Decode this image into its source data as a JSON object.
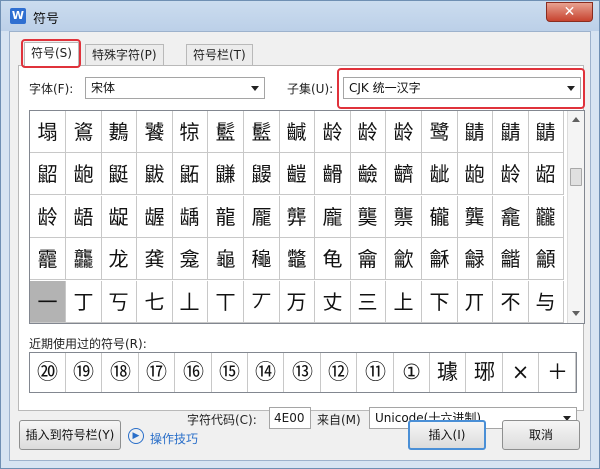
{
  "window": {
    "title": "符号",
    "close_label": "✕",
    "app_icon_label": "W"
  },
  "tabs": [
    {
      "label": "符号(S)"
    },
    {
      "label": "特殊字符(P)"
    },
    {
      "label": "符号栏(T)"
    }
  ],
  "font": {
    "label": "字体(F):",
    "value": "宋体"
  },
  "subset": {
    "label": "子集(U):",
    "value": "CJK 统一汉字"
  },
  "symbol_rows": [
    [
      "塌",
      "䳐",
      "鶈",
      "饕",
      "㹁",
      "䰐",
      "䰐",
      "䶢",
      "龄",
      "龄",
      "龄",
      "鹭",
      "鼱",
      "鼱",
      "鼱"
    ],
    [
      "鼦",
      "龅",
      "鼮",
      "鼥",
      "鼫",
      "鼸",
      "鼹",
      "䶣",
      "䶤",
      "䶨",
      "䶩",
      "龇",
      "龅",
      "龄",
      "龆"
    ],
    [
      "龄",
      "龉",
      "龊",
      "龌",
      "龋",
      "龍",
      "龎",
      "龏",
      "龐",
      "龑",
      "龒",
      "龓",
      "龔",
      "龕",
      "龖"
    ],
    [
      "龗",
      "龘",
      "龙",
      "龚",
      "龛",
      "龜",
      "龝",
      "龞",
      "龟",
      "龠",
      "龡",
      "龢",
      "龣",
      "龤",
      "龥"
    ],
    [
      "一",
      "丁",
      "丂",
      "七",
      "丄",
      "丅",
      "丆",
      "万",
      "丈",
      "三",
      "上",
      "下",
      "丌",
      "不",
      "与"
    ]
  ],
  "recent": {
    "label": "近期使用过的符号(R):",
    "items": [
      "⑳",
      "⑲",
      "⑱",
      "⑰",
      "⑯",
      "⑮",
      "⑭",
      "⑬",
      "⑫",
      "⑪",
      "①",
      "璩",
      "琊",
      "×",
      "＋"
    ]
  },
  "char_code": {
    "label": "字符代码(C):",
    "value": "4E00"
  },
  "from": {
    "label": "来自(M)",
    "value": "Unicode(十六进制)"
  },
  "buttons": {
    "insert_to_bar": "插入到符号栏(Y)",
    "tips": "操作技巧",
    "insert": "插入(I)",
    "cancel": "取消"
  },
  "colors": {
    "highlight": "#e0323b",
    "link": "#2a6fc9",
    "selected_cell": "#b3b3b3"
  }
}
